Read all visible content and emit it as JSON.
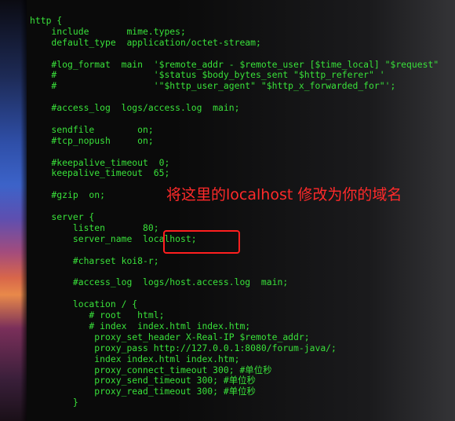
{
  "code_lines": [
    "http {",
    "    include       mime.types;",
    "    default_type  application/octet-stream;",
    "",
    "    #log_format  main  '$remote_addr - $remote_user [$time_local] \"$request\"",
    "    #                  '$status $body_bytes_sent \"$http_referer\" '",
    "    #                  '\"$http_user_agent\" \"$http_x_forwarded_for\"';",
    "",
    "    #access_log  logs/access.log  main;",
    "",
    "    sendfile        on;",
    "    #tcp_nopush     on;",
    "",
    "    #keepalive_timeout  0;",
    "    keepalive_timeout  65;",
    "",
    "    #gzip  on;",
    "",
    "    server {",
    "        listen       80;",
    "        server_name  localhost;",
    "",
    "        #charset koi8-r;",
    "",
    "        #access_log  logs/host.access.log  main;",
    "",
    "        location / {",
    "           # root   html;",
    "           # index  index.html index.htm;",
    "            proxy_set_header X-Real-IP $remote_addr;",
    "            proxy_pass http://127.0.0.1:8080/forum-java/;",
    "            index index.html index.htm;",
    "            proxy_connect_timeout 300; #单位秒",
    "            proxy_send_timeout 300; #单位秒",
    "            proxy_read_timeout 300; #单位秒",
    "        }"
  ],
  "annotation": {
    "text": "将这里的localhost 修改为你的域名",
    "color": "#ff2a2a"
  },
  "theme": {
    "terminal_background": "#0a0a0a",
    "code_color": "#39e13a",
    "highlight_color": "#ff1f1f"
  }
}
